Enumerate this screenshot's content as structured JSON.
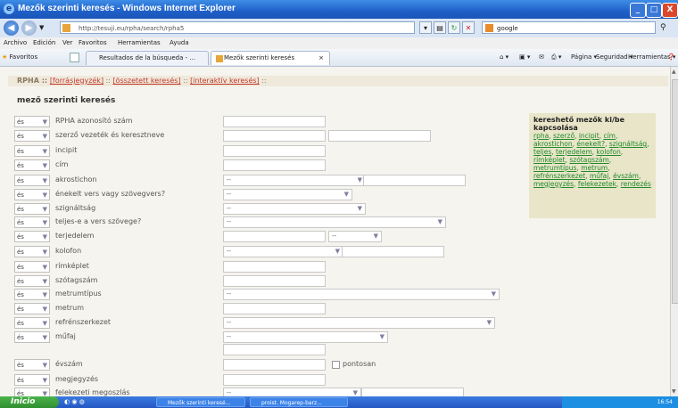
{
  "window": {
    "title": "Mezők szerinti keresés - Windows Internet Explorer",
    "min": "_",
    "max": "□",
    "close": "X"
  },
  "addressbar": {
    "url": "http://tesuji.eu/rpha/search/rpha5",
    "search_value": "google",
    "refresh": "↻",
    "stop": "✕"
  },
  "menu": [
    "Archivo",
    "Edición",
    "Ver",
    "Favoritos",
    "Herramientas",
    "Ayuda"
  ],
  "favbar": {
    "favorites": "Favoritos",
    "tab1": "Resultados de la búsqueda - ...",
    "tab2": "Mezők szerinti keresés",
    "cmd_page": "Página",
    "cmd_security": "Seguridad",
    "cmd_tools": "Herramientas"
  },
  "breadcrumb": {
    "prefix": "RPHA :: ",
    "link1": "[forrásjegyzék]",
    "sep1": " :: ",
    "link2": "[összetett keresés]",
    "sep2": " :: ",
    "link3": "[interaktív keresés]",
    "suffix": " ::"
  },
  "page_title": "mező szerinti keresés",
  "conj": "és",
  "fields": [
    "RPHA azonosító szám",
    "szerző vezeték és keresztneve",
    "incipit",
    "cím",
    "akrostichon",
    "énekelt vers vagy szövegvers?",
    "szignáltság",
    "teljes-e a vers szövege?",
    "terjedelem",
    "kolofon",
    "rímképlet",
    "szótagszám",
    "metrumtípus",
    "metrum",
    "refrénszerkezet",
    "műfaj",
    "évszám",
    "megjegyzés",
    "felekezeti megoszlás"
  ],
  "select_default": "--",
  "pontosan": "pontosan",
  "sidebox": {
    "heading": "kereshető mezők ki/be kapcsolása",
    "links": [
      "rpha",
      "szerző",
      "incipit",
      "cím",
      "akrostichon",
      "énekelt?",
      "szignáltság",
      "teljes",
      "terjedelem",
      "kolofon",
      "rímképlet",
      "szótagszám",
      "metrumtípus",
      "metrum",
      "refrénszerkezet",
      "műfaj",
      "évszám",
      "megjegyzés",
      "felekezetek",
      "rendezés"
    ]
  },
  "taskbar": {
    "start": "Inicio",
    "item1": "Mezők szerinti keresé...",
    "item2": "proist. Mogarep-barz...",
    "clock": "16:54"
  }
}
